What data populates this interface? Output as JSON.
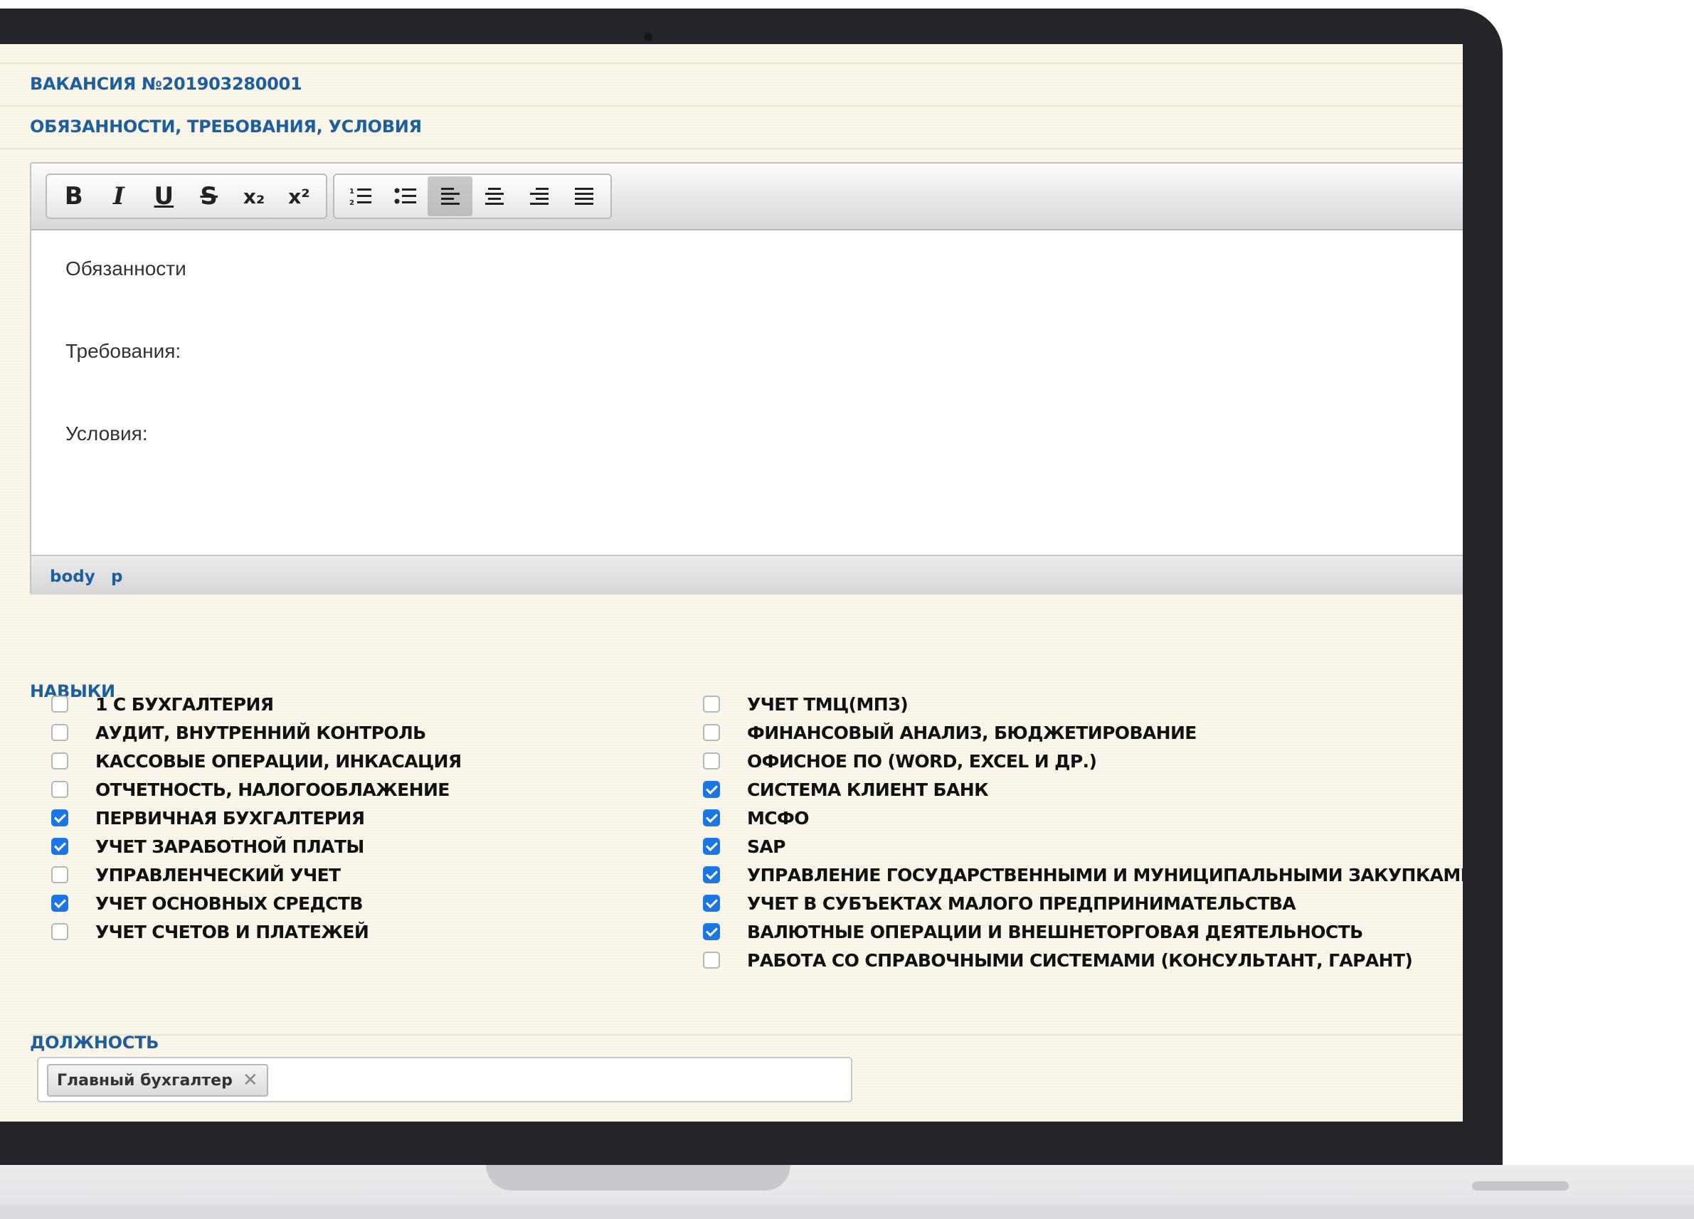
{
  "vacancy": {
    "title": "ВАКАНСИЯ №201903280001"
  },
  "duties": {
    "title": "ОБЯЗАННОСТИ, ТРЕБОВАНИЯ, УСЛОВИЯ"
  },
  "editor": {
    "toolbar": {
      "bold": "B",
      "italic": "I",
      "underline": "U",
      "strike": "S",
      "subscript": "x₂",
      "superscript": "x²"
    },
    "active_alignment": "left",
    "paragraphs": [
      "Обязанности",
      "Требования:",
      "Условия:"
    ],
    "path": [
      "body",
      "p"
    ]
  },
  "skills": {
    "title": "НАВЫКИ",
    "left": [
      {
        "label": "1 С БУХГАЛТЕРИЯ",
        "checked": false
      },
      {
        "label": "АУДИТ, ВНУТРЕННИЙ КОНТРОЛЬ",
        "checked": false
      },
      {
        "label": "КАССОВЫЕ ОПЕРАЦИИ, ИНКАСАЦИЯ",
        "checked": false
      },
      {
        "label": "ОТЧЕТНОСТЬ, НАЛОГООБЛАЖЕНИЕ",
        "checked": false
      },
      {
        "label": "ПЕРВИЧНАЯ БУХГАЛТЕРИЯ",
        "checked": true
      },
      {
        "label": "УЧЕТ ЗАРАБОТНОЙ ПЛАТЫ",
        "checked": true
      },
      {
        "label": "УПРАВЛЕНЧЕСКИЙ УЧЕТ",
        "checked": false
      },
      {
        "label": "УЧЕТ ОСНОВНЫХ СРЕДСТВ",
        "checked": true
      },
      {
        "label": "УЧЕТ СЧЕТОВ И ПЛАТЕЖЕЙ",
        "checked": false
      }
    ],
    "right": [
      {
        "label": "УЧЕТ ТМЦ(МПЗ)",
        "checked": false
      },
      {
        "label": "ФИНАНСОВЫЙ АНАЛИЗ, БЮДЖЕТИРОВАНИЕ",
        "checked": false
      },
      {
        "label": "ОФИСНОЕ ПО (WORD, EXCEL И ДР.)",
        "checked": false
      },
      {
        "label": "СИСТЕМА КЛИЕНТ БАНК",
        "checked": true
      },
      {
        "label": "МСФО",
        "checked": true
      },
      {
        "label": "SAP",
        "checked": true
      },
      {
        "label": "УПРАВЛЕНИЕ ГОСУДАРСТВЕННЫМИ И МУНИЦИПАЛЬНЫМИ ЗАКУПКАМИ",
        "checked": true
      },
      {
        "label": "УЧЕТ В СУБЪЕКТАХ МАЛОГО ПРЕДПРИНИМАТЕЛЬСТВА",
        "checked": true
      },
      {
        "label": "ВАЛЮТНЫЕ ОПЕРАЦИИ И ВНЕШНЕТОРГОВАЯ ДЕЯТЕЛЬНОСТЬ",
        "checked": true
      },
      {
        "label": "РАБОТА СО СПРАВОЧНЫМИ СИСТЕМАМИ (КОНСУЛЬТАНТ, ГАРАНТ)",
        "checked": false
      }
    ]
  },
  "position": {
    "title": "ДОЛЖНОСТЬ",
    "tags": [
      {
        "label": "Главный бухгалтер",
        "remove": "✕"
      }
    ]
  },
  "colors": {
    "header": "#1d5e9e",
    "checkbox_on": "#1976e4"
  }
}
